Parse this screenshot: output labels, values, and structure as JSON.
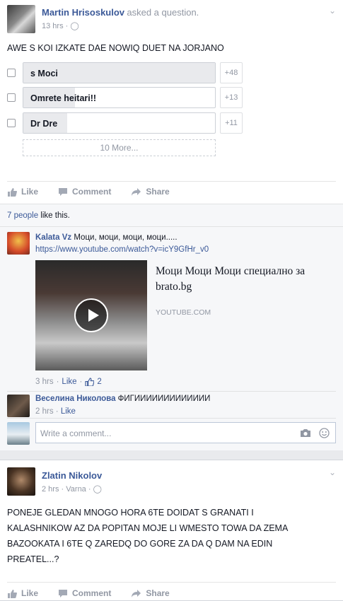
{
  "post1": {
    "author": "Martin Hrisoskulov",
    "action": "asked a question.",
    "time": "13 hrs",
    "question": "AWE S KOI IZKATE DAE NOWIQ DUET NA JORJANO",
    "options": [
      {
        "label": "s Moci",
        "count": "+48",
        "share": 1.0
      },
      {
        "label": "Omrete heitari!!",
        "count": "+13",
        "share": 0.27
      },
      {
        "label": "Dr Dre",
        "count": "+11",
        "share": 0.23
      }
    ],
    "more": "10 More...",
    "actions": {
      "like": "Like",
      "comment": "Comment",
      "share": "Share"
    },
    "likes_count": "7 people",
    "likes_suffix": " like this.",
    "comments": [
      {
        "author": "Kalata Vz",
        "text": "Моци, моци, моци, моци.....",
        "link": "https://www.youtube.com/watch?v=icY9GfHr_v0",
        "preview_title": "Моци Моци Моци специално за brato.bg",
        "preview_source": "YOUTUBE.COM",
        "time": "3 hrs",
        "like": "Like",
        "like_count": "2"
      },
      {
        "author": "Веселина Николова",
        "text": "ФИГИИИИИИИИИИИИИ",
        "time": "2 hrs",
        "like": "Like"
      }
    ],
    "comment_placeholder": "Write a comment..."
  },
  "post2": {
    "author": "Zlatin Nikolov",
    "time": "2 hrs",
    "location": "Varna",
    "text": "PONEJE GLEDAN MNOGO HORA 6TE DOIDAT S GRANATI I KALASHNIKOW AZ DA POPITAN MOJE LI WMESTO TOWA DA ZEMA BAZOOKATA I 6TE Q ZAREDQ DO GORE ZA DA Q DAM NA EDIN PREATEL...?",
    "actions": {
      "like": "Like",
      "comment": "Comment",
      "share": "Share"
    }
  },
  "colors": {
    "link": "#3b5998",
    "muted": "#9197a3",
    "bg": "#e9eaed"
  }
}
